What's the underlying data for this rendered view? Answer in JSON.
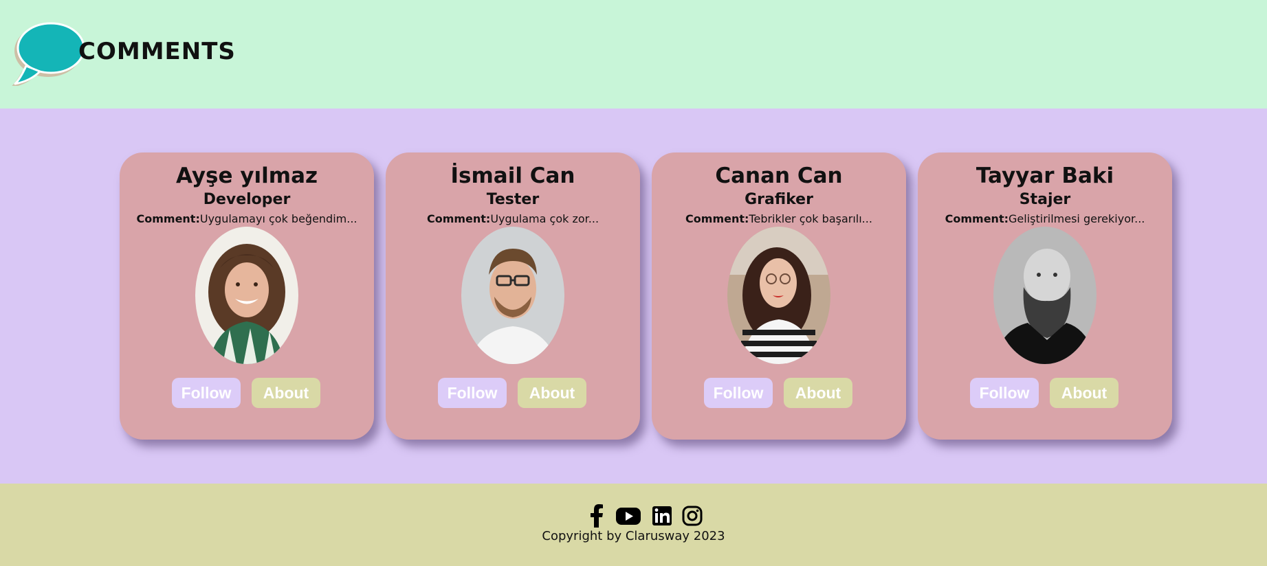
{
  "header": {
    "brand": "COMMENTS",
    "logo_icon": "speech-bubble-icon"
  },
  "cards": [
    {
      "name": "Ayşe yılmaz",
      "role": "Developer",
      "comment_label": "Comment:",
      "comment_text": "Uygulamayı çok beğendim...",
      "follow_label": "Follow",
      "about_label": "About"
    },
    {
      "name": "İsmail Can",
      "role": "Tester",
      "comment_label": "Comment:",
      "comment_text": "Uygulama çok zor...",
      "follow_label": "Follow",
      "about_label": "About"
    },
    {
      "name": "Canan Can",
      "role": "Grafiker",
      "comment_label": "Comment:",
      "comment_text": "Tebrikler çok başarılı...",
      "follow_label": "Follow",
      "about_label": "About"
    },
    {
      "name": "Tayyar Baki",
      "role": "Stajer",
      "comment_label": "Comment:",
      "comment_text": "Geliştirilmesi gerekiyor...",
      "follow_label": "Follow",
      "about_label": "About"
    }
  ],
  "footer": {
    "social_icons": [
      "facebook-icon",
      "youtube-icon",
      "linkedin-icon",
      "instagram-icon"
    ],
    "copyright": "Copyright by Clarusway 2023"
  },
  "colors": {
    "header_bg": "#c8f5d8",
    "main_bg": "#d9c7f5",
    "footer_bg": "#d9d9a6",
    "card_bg": "#d9a4a9",
    "follow_bg": "#dcccf8",
    "about_bg": "#d9d9a6",
    "logo_teal": "#14b5b7"
  }
}
